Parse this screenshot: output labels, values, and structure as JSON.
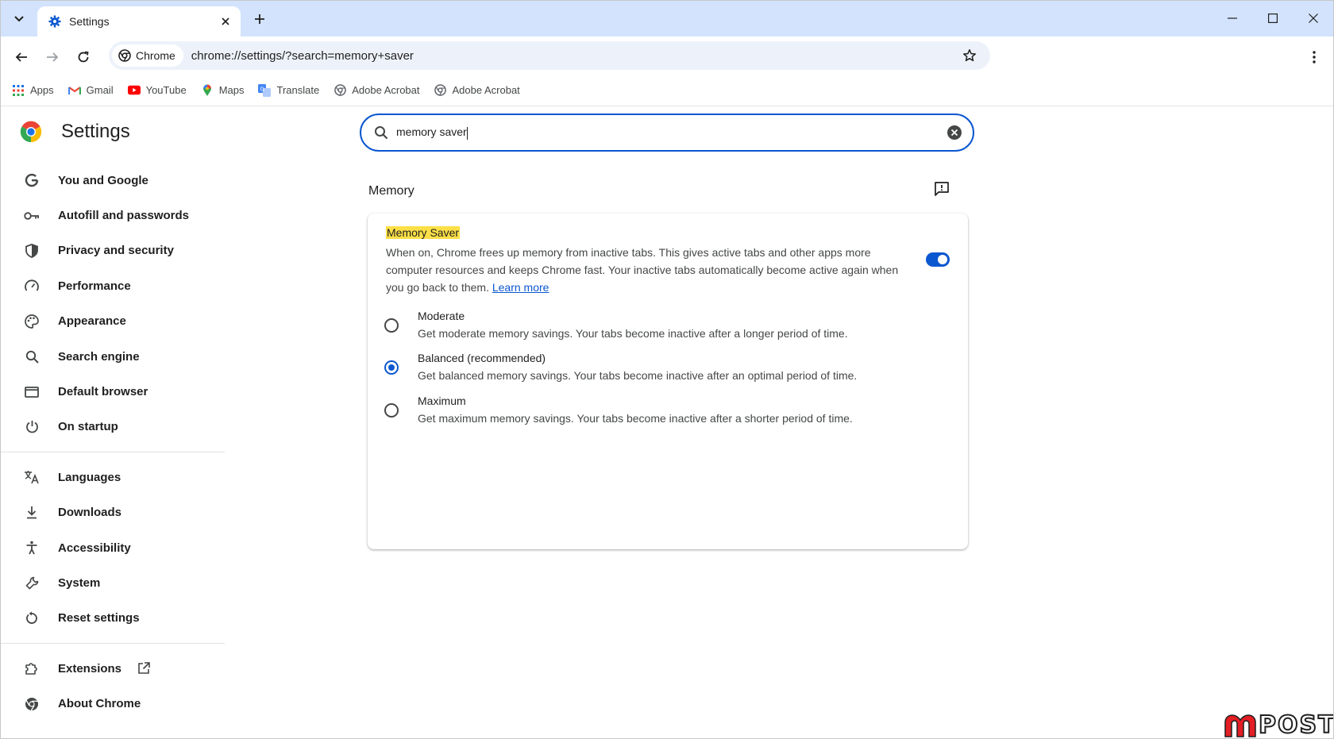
{
  "tabs": [
    {
      "title": "Settings"
    }
  ],
  "toolbar": {
    "chip_label": "Chrome",
    "url": "chrome://settings/?search=memory+saver"
  },
  "bookmarks": [
    {
      "label": "Apps",
      "icon": "apps-grid-icon"
    },
    {
      "label": "Gmail",
      "icon": "gmail-icon"
    },
    {
      "label": "YouTube",
      "icon": "youtube-icon"
    },
    {
      "label": "Maps",
      "icon": "maps-icon"
    },
    {
      "label": "Translate",
      "icon": "translate-icon"
    },
    {
      "label": "Adobe Acrobat",
      "icon": "globe-icon"
    },
    {
      "label": "Adobe Acrobat",
      "icon": "globe-icon"
    }
  ],
  "settings": {
    "title": "Settings",
    "search_value": "memory saver",
    "nav_group1": [
      {
        "label": "You and Google",
        "icon": "google-g-icon"
      },
      {
        "label": "Autofill and passwords",
        "icon": "key-icon"
      },
      {
        "label": "Privacy and security",
        "icon": "shield-icon"
      },
      {
        "label": "Performance",
        "icon": "speedometer-icon"
      },
      {
        "label": "Appearance",
        "icon": "palette-icon"
      },
      {
        "label": "Search engine",
        "icon": "search-icon"
      },
      {
        "label": "Default browser",
        "icon": "browser-window-icon"
      },
      {
        "label": "On startup",
        "icon": "power-icon"
      }
    ],
    "nav_group2": [
      {
        "label": "Languages",
        "icon": "translate-icon"
      },
      {
        "label": "Downloads",
        "icon": "download-icon"
      },
      {
        "label": "Accessibility",
        "icon": "accessibility-icon"
      },
      {
        "label": "System",
        "icon": "wrench-icon"
      },
      {
        "label": "Reset settings",
        "icon": "reset-icon"
      }
    ],
    "nav_group3": [
      {
        "label": "Extensions",
        "icon": "puzzle-icon"
      },
      {
        "label": "About Chrome",
        "icon": "chrome-icon"
      }
    ],
    "section_title": "Memory",
    "memory_saver": {
      "title": "Memory Saver",
      "description": "When on, Chrome frees up memory from inactive tabs. This gives active tabs and other apps more computer resources and keeps Chrome fast. Your inactive tabs automatically become active again when you go back to them.",
      "learn_more": "Learn more",
      "enabled": true,
      "options": [
        {
          "label": "Moderate",
          "sub": "Get moderate memory savings. Your tabs become inactive after a longer period of time.",
          "selected": false
        },
        {
          "label": "Balanced (recommended)",
          "sub": "Get balanced memory savings. Your tabs become inactive after an optimal period of time.",
          "selected": true
        },
        {
          "label": "Maximum",
          "sub": "Get maximum memory savings. Your tabs become inactive after a shorter period of time.",
          "selected": false
        }
      ]
    }
  },
  "watermark": {
    "text": "POST"
  },
  "colors": {
    "accent": "#0b57d0",
    "tabstrip": "#d3e3fd",
    "highlight": "#fde047"
  }
}
